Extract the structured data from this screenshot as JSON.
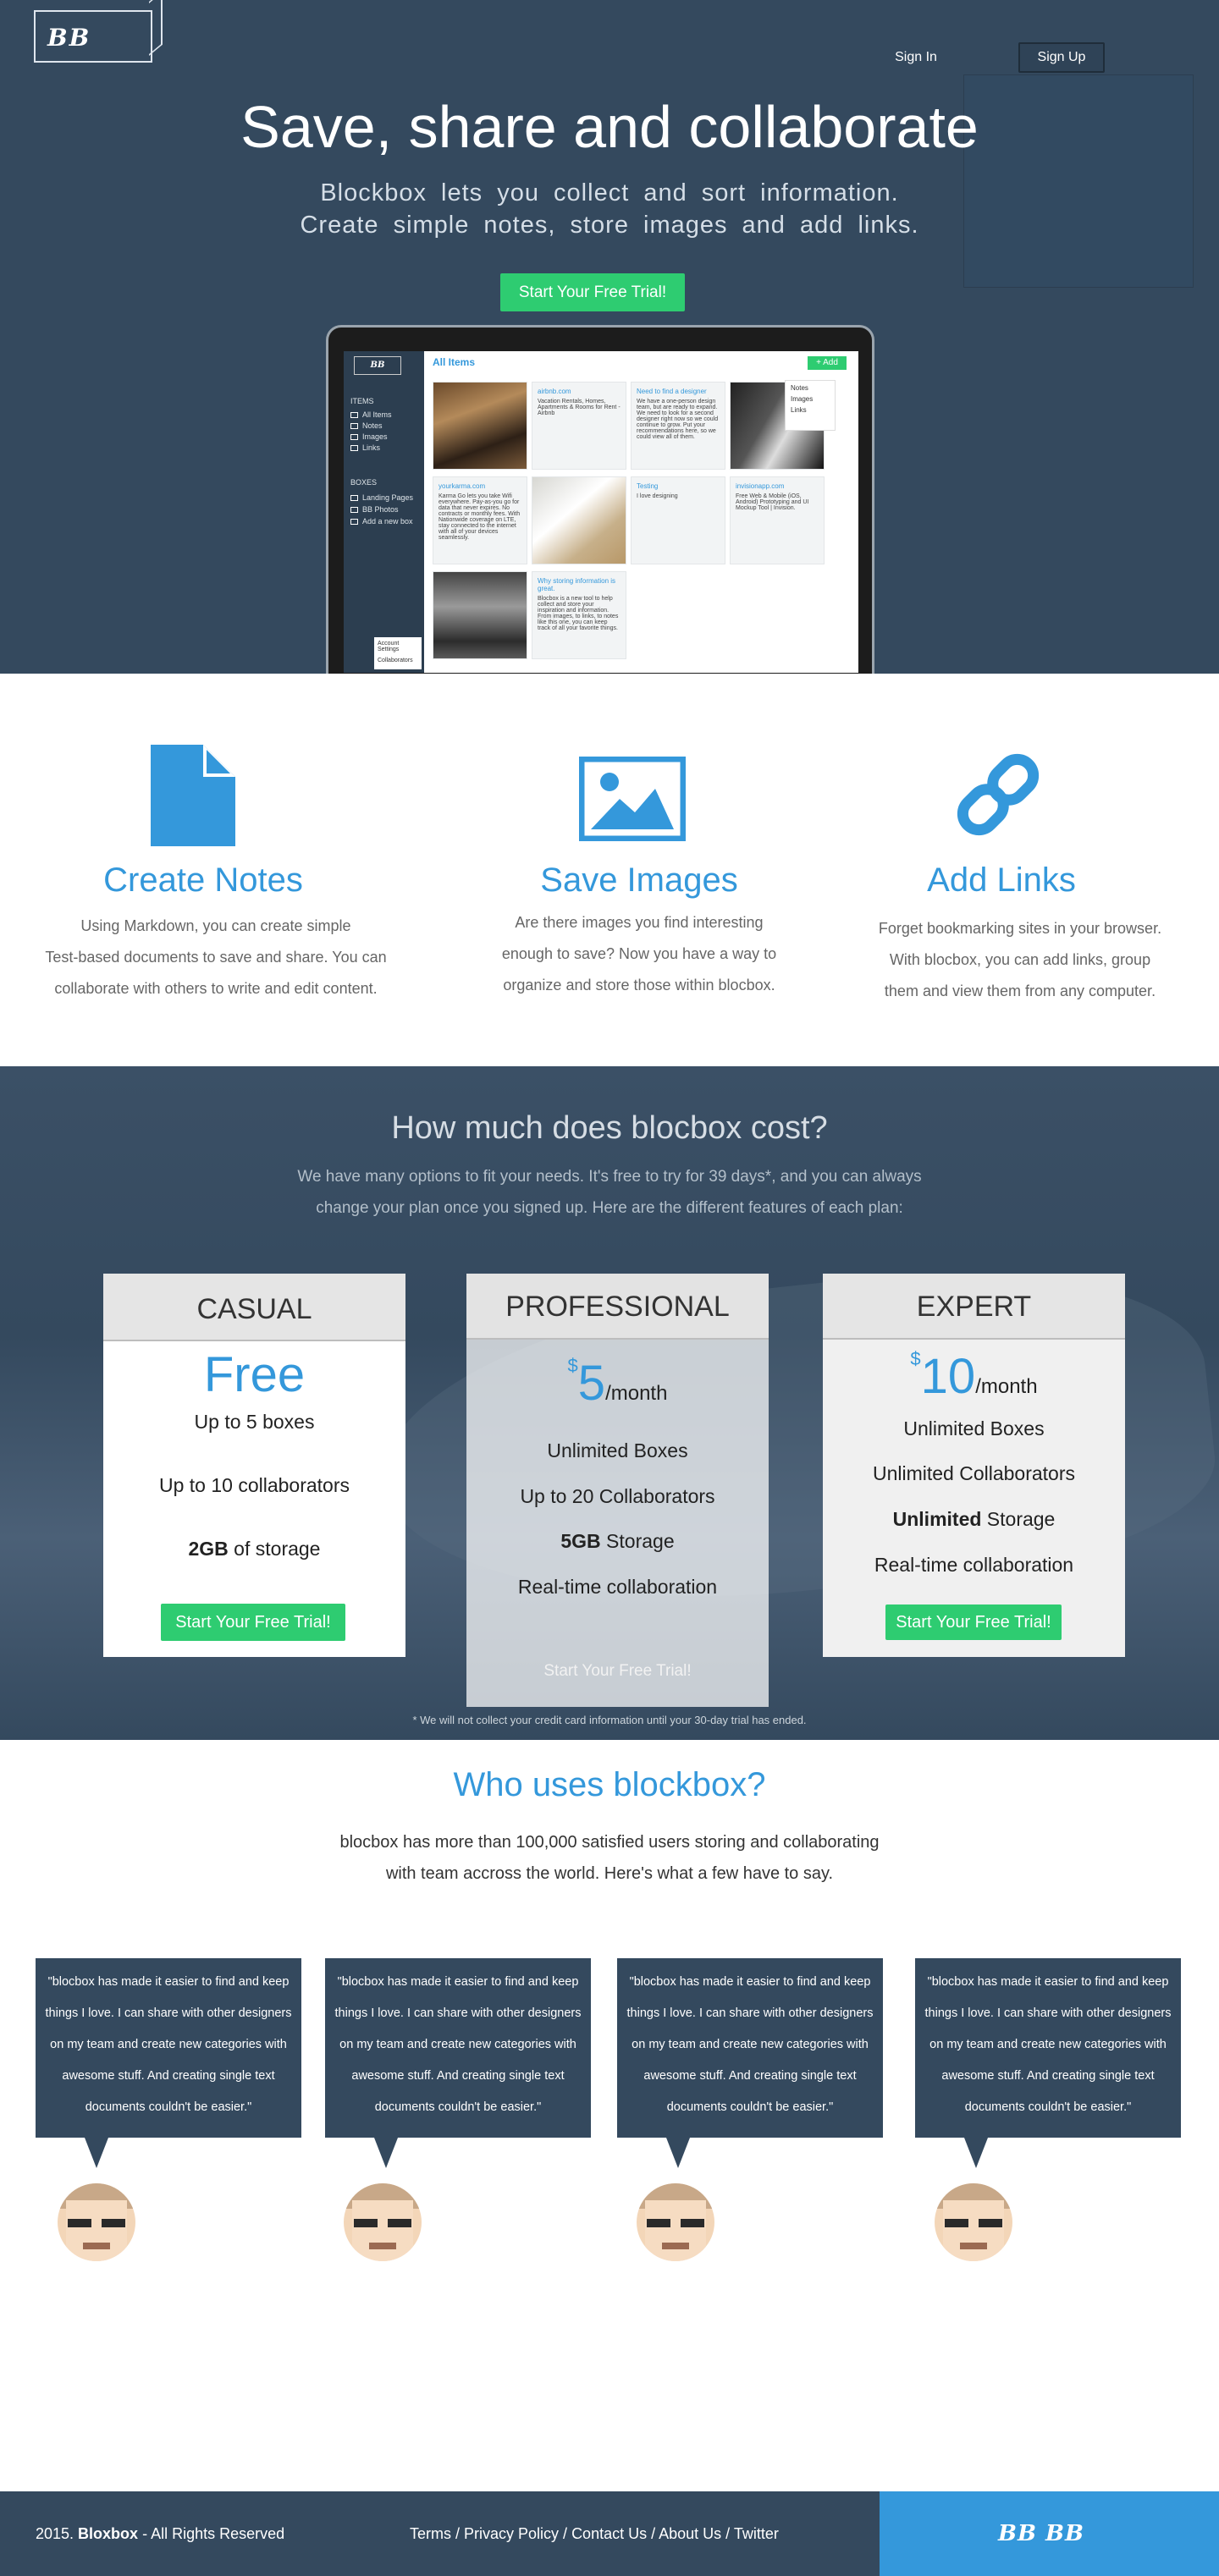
{
  "header": {
    "logo_text": "BB",
    "signin_label": "Sign In",
    "signup_label": "Sign Up"
  },
  "hero": {
    "title": "Save, share and collaborate",
    "subtitle_line1": "Blockbox lets you collect and sort information.",
    "subtitle_line2": "Create simple notes, store images and add links.",
    "cta_label": "Start Your Free Trial!"
  },
  "app_preview": {
    "logo": "BB",
    "items_heading": "ITEMS",
    "items": [
      "All Items",
      "Notes",
      "Images",
      "Links"
    ],
    "boxes_heading": "BOXES",
    "boxes": [
      "Landing Pages",
      "BB Photos",
      "Add a new box"
    ],
    "account": [
      "Account Settings",
      "Collaborators"
    ],
    "main_title": "All Items",
    "add_label": "+ Add",
    "menu": [
      "Notes",
      "Images",
      "Links"
    ],
    "cards": [
      {
        "title": "airbnb.com",
        "text": "Vacation Rentals, Homes, Apartments & Rooms for Rent - Airbnb"
      },
      {
        "title": "Need to find a designer",
        "text": "We have a one-person design team, but are ready to expand. We need to look for a second designer right now so we could continue to grow. Put your recommendations here, so we could view all of them."
      },
      {
        "title": "yourkarma.com",
        "text": "Karma Go lets you take Wifi everywhere. Pay-as-you go for data that never expires. No contracts or monthly fees. With Nationwide coverage on LTE, stay connected to the internet with all of your devices seamlessly."
      },
      {
        "title": "Testing",
        "text": "I love designing"
      },
      {
        "title": "invisionapp.com",
        "text": "Free Web & Mobile (iOS, Android) Prototyping and UI Mockup Tool | Invision."
      },
      {
        "title": "Why storing information is great.",
        "text": "Blocbox is a new tool to help collect and store your inspiration and information. From images, to links, to notes like this one, you can keep track of all your favorite things."
      }
    ]
  },
  "features": [
    {
      "title": "Create Notes",
      "text_lines": [
        "Using Markdown, you can create simple",
        "Test-based documents to save and share. You can",
        "collaborate with others to write and edit content."
      ],
      "icon": "document-icon"
    },
    {
      "title": "Save Images",
      "text_lines": [
        "Are there images you find interesting",
        "enough to save? Now you have a way to",
        "organize and store those within blocbox."
      ],
      "icon": "image-icon"
    },
    {
      "title": "Add Links",
      "text_lines": [
        "Forget bookmarking sites in your browser.",
        "With blocbox, you can add links, group",
        "them and view them from any computer."
      ],
      "icon": "link-icon"
    }
  ],
  "pricing": {
    "question": "How much does blocbox cost?",
    "intro_line1": "We have many options to fit your needs. It's free to try for 39 days*, and you can always",
    "intro_line2": "change your plan once you signed up. Here are the different features of each plan:",
    "note": "* We will not collect your credit card information until your 30-day trial has ended.",
    "plans": [
      {
        "name": "CASUAL",
        "price": "Free",
        "features": [
          "Up to 5 boxes",
          "Up to 10 collaborators"
        ],
        "storage_bold": "2GB",
        "storage_rest": " of storage",
        "cta": "Start Your Free Trial!"
      },
      {
        "name": "PROFESSIONAL",
        "currency": "$",
        "price": "5",
        "period": "/month",
        "features": [
          "Unlimited Boxes",
          "Up to 20 Collaborators"
        ],
        "storage_bold": "5GB",
        "storage_rest": " Storage",
        "extra": "Real-time collaboration",
        "cta": "Start Your Free Trial!"
      },
      {
        "name": "EXPERT",
        "currency": "$",
        "price": "10",
        "period": "/month",
        "features": [
          "Unlimited Boxes",
          "Unlimited Collaborators"
        ],
        "storage_bold": "Unlimited",
        "storage_rest": " Storage",
        "extra": "Real-time collaboration",
        "cta": "Start Your Free Trial!"
      }
    ]
  },
  "testimonials": {
    "title": "Who uses blockbox?",
    "intro_line1": "blocbox has more than 100,000 satisfied users storing and collaborating",
    "intro_line2": "with team accross the world. Here's what a few have to say.",
    "quote_lines": [
      "\"blocbox has made it easier to find and keep",
      "things I love. I can share with other designers",
      "on my team and create new categories with",
      "awesome stuff. And creating single text",
      "documents couldn't be easier.\""
    ]
  },
  "footer": {
    "copy_prefix": "2015. ",
    "copy_brand": "Bloxbox",
    "copy_suffix": " - All Rights Reserved",
    "links": [
      "Terms",
      "Privacy Policy",
      "Contact Us",
      "About Us",
      "Twitter"
    ],
    "brand_logo": "BB BB"
  },
  "colors": {
    "navy": "#34495e",
    "blue": "#3498db",
    "green": "#2ecc71"
  }
}
